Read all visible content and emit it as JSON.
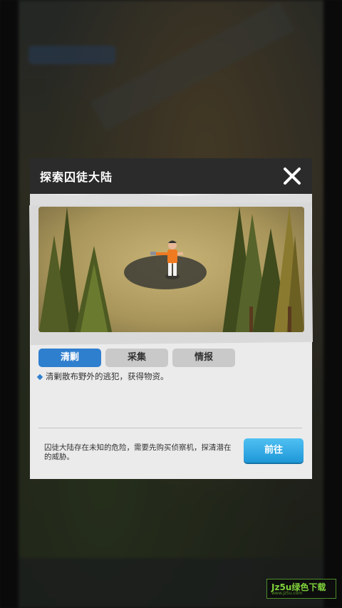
{
  "dialog": {
    "title": "探索囚徒大陆",
    "close_icon": "close-icon"
  },
  "tabs": [
    {
      "label": "清剿",
      "active": true
    },
    {
      "label": "采集",
      "active": false
    },
    {
      "label": "情报",
      "active": false
    }
  ],
  "description": "清剿散布野外的逃犯，获得物资。",
  "footer": {
    "note": "囚徒大陆存在未知的危险，需要先购买侦察机，探清潜在的威胁。",
    "go_button": "前往"
  },
  "watermark": {
    "text": "Jz5u绿色下载",
    "sub": "www.jz5u.com"
  },
  "colors": {
    "accent": "#2f7fcf",
    "button": "#22a0e0",
    "header": "#2b2b2b"
  }
}
